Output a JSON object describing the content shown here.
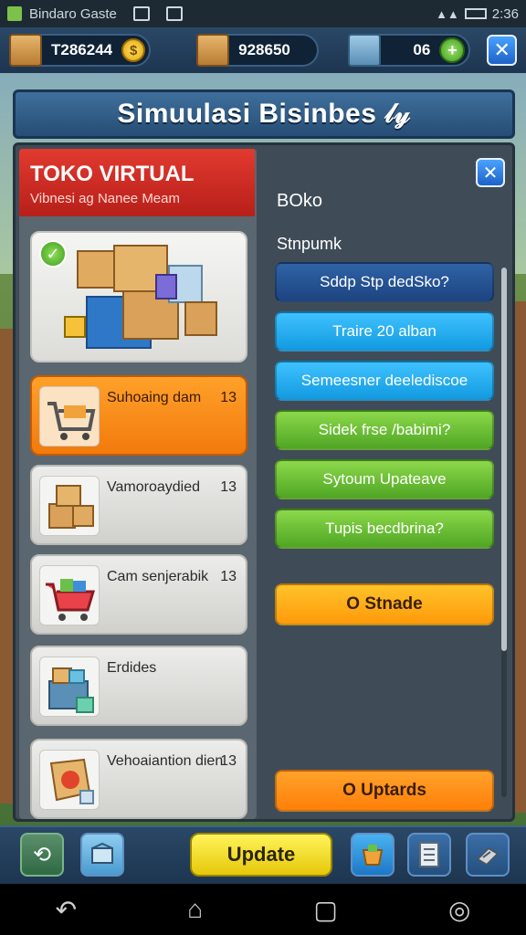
{
  "status_bar": {
    "app_name": "Bindaro Gaste",
    "signal": "▲▲",
    "time": "2:36"
  },
  "resources": {
    "crates": "T286244",
    "stock": "928650",
    "inventory": "06",
    "coin_symbol": "$",
    "plus_symbol": "+",
    "close_symbol": "✕"
  },
  "title": "Simuulasi Bisinbes 𝓁𝓎",
  "store": {
    "title": "TOKO VIRTUAL",
    "subtitle": "Vibnesi ag Nanee Meam"
  },
  "hero": {
    "check_symbol": "✓"
  },
  "categories": [
    {
      "label": "Suhoaing dam",
      "count": "13",
      "icon": "shopping-cart-icon",
      "active": true
    },
    {
      "label": "Vamoroaydied",
      "count": "13",
      "icon": "boxes-icon",
      "active": false
    },
    {
      "label": "Cam senjerabik",
      "count": "13",
      "icon": "cart-goods-icon",
      "active": false
    },
    {
      "label": "Erdides",
      "count": "",
      "icon": "crate-icon",
      "active": false
    },
    {
      "label": "Vehoaiantion dien",
      "count": "13",
      "icon": "badge-box-icon",
      "active": false
    }
  ],
  "detail": {
    "close_symbol": "✕",
    "heading": "BOko",
    "subheading": "Stnpumk",
    "buttons": [
      {
        "label": "Sddp Stp dedSko?",
        "style": "dark"
      },
      {
        "label": "Traire 20 alban",
        "style": "cyan"
      },
      {
        "label": "Semeesner deelediscoe",
        "style": "cyan"
      },
      {
        "label": "Sidek frse /babimi?",
        "style": "green"
      },
      {
        "label": "Sytoum Upateave",
        "style": "green"
      },
      {
        "label": "Tupis becdbrina?",
        "style": "green"
      }
    ],
    "primary_button": "O Stnade",
    "bottom_button": "O Uptards"
  },
  "toolbar": {
    "update_label": "Update",
    "back_icon": "⟲",
    "items": [
      "back-icon",
      "crate-icon",
      "basket-icon",
      "list-icon",
      "settings-icon"
    ]
  },
  "nav": {
    "back": "↶",
    "home": "⌂",
    "recents": "▢",
    "assist": "◎"
  },
  "colors": {
    "accent_red": "#d9302a",
    "accent_orange": "#f7901a",
    "accent_blue": "#1d62c8",
    "panel": "#3f4c57"
  }
}
